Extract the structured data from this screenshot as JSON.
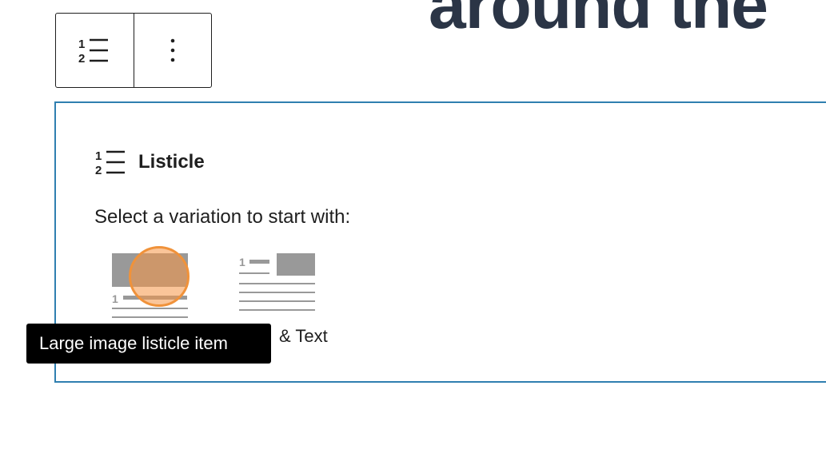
{
  "page": {
    "heading_fragment": "around the"
  },
  "toolbar": {
    "block_type_icon": "numbered-list-icon",
    "options_icon": "vertical-ellipsis-icon"
  },
  "block": {
    "title": "Listicle",
    "title_icon": "numbered-list-icon",
    "instructions": "Select a variation to start with:",
    "variations": [
      {
        "name": "Large image listicle item",
        "icon": "large-image-variation-icon"
      },
      {
        "label_fragment": "& Text",
        "icon": "image-and-text-variation-icon"
      }
    ]
  },
  "tooltip": {
    "text": "Large image listicle item"
  },
  "colors": {
    "block_border": "#2f7fb0",
    "heading": "#2b3546",
    "click_marker": "#f0923a",
    "tooltip_bg": "#000000",
    "placeholder_gray": "#999999"
  }
}
